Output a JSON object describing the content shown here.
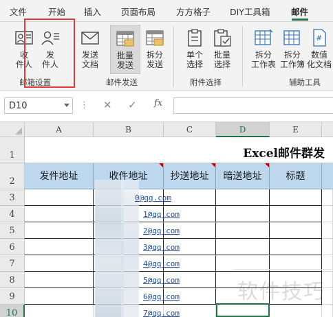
{
  "tabs": [
    "文件",
    "开始",
    "插入",
    "页面布局",
    "方方格子",
    "DIY工具箱",
    "邮件"
  ],
  "active_tab": "邮件",
  "ribbon": {
    "groups": [
      {
        "label": "邮箱设置",
        "buttons": [
          {
            "label_line1": "收",
            "label_line2": "件人",
            "icon": "recipient-icon"
          },
          {
            "label_line1": "发",
            "label_line2": "件人",
            "icon": "sender-icon"
          }
        ]
      },
      {
        "label": "邮件发送",
        "buttons": [
          {
            "label_line1": "发送",
            "label_line2": "文档",
            "icon": "envelope-icon"
          },
          {
            "label_line1": "批量",
            "label_line2": "发送",
            "icon": "batch-send-icon"
          },
          {
            "label_line1": "拆分",
            "label_line2": "发送",
            "icon": "split-send-icon"
          }
        ]
      },
      {
        "label": "附件选择",
        "buttons": [
          {
            "label_line1": "单个",
            "label_line2": "选择",
            "icon": "clipboard-icon"
          },
          {
            "label_line1": "批量",
            "label_line2": "选择",
            "icon": "clipboard-check-icon"
          }
        ]
      },
      {
        "label": "辅助工具",
        "buttons": [
          {
            "label_line1": "拆分",
            "label_line2": "工作表",
            "icon": "split-sheet-icon"
          },
          {
            "label_line1": "拆分",
            "label_line2": "工作簿",
            "icon": "split-book-icon"
          },
          {
            "label_line1": "数值",
            "label_line2": "化文档",
            "icon": "number-doc-icon"
          }
        ]
      }
    ]
  },
  "formula_bar": {
    "name_box": "D10",
    "fx": "fx",
    "cancel": "✕",
    "enter": "✓",
    "value": ""
  },
  "sheet": {
    "columns": [
      "A",
      "B",
      "C",
      "D",
      "E"
    ],
    "selected_column": "D",
    "rows": [
      "1",
      "2",
      "3",
      "4",
      "5",
      "6",
      "7",
      "8",
      "9",
      "10"
    ],
    "selected_row": "10",
    "title": "Excel邮件群发",
    "headers": [
      "发件地址",
      "收件地址",
      "抄送地址",
      "暗送地址",
      "标题"
    ],
    "emails": [
      "4▒▒0@qq.com",
      "▒1@qq.com",
      "▒2@qq.com",
      "▒3@qq.com",
      "▒4@qq.com",
      "▒5@qq.com",
      "▒6@qq.com",
      "▒7@qq.com"
    ],
    "email_suffix": "@qq.com",
    "email_digits": [
      "0",
      "1",
      "2",
      "3",
      "4",
      "5",
      "6",
      "7"
    ]
  },
  "watermark": "软件技巧",
  "colors": {
    "accent": "#217346",
    "header_fill": "#bdd7ee",
    "highlight": "#e03a3a",
    "link": "#1f4ea8"
  }
}
